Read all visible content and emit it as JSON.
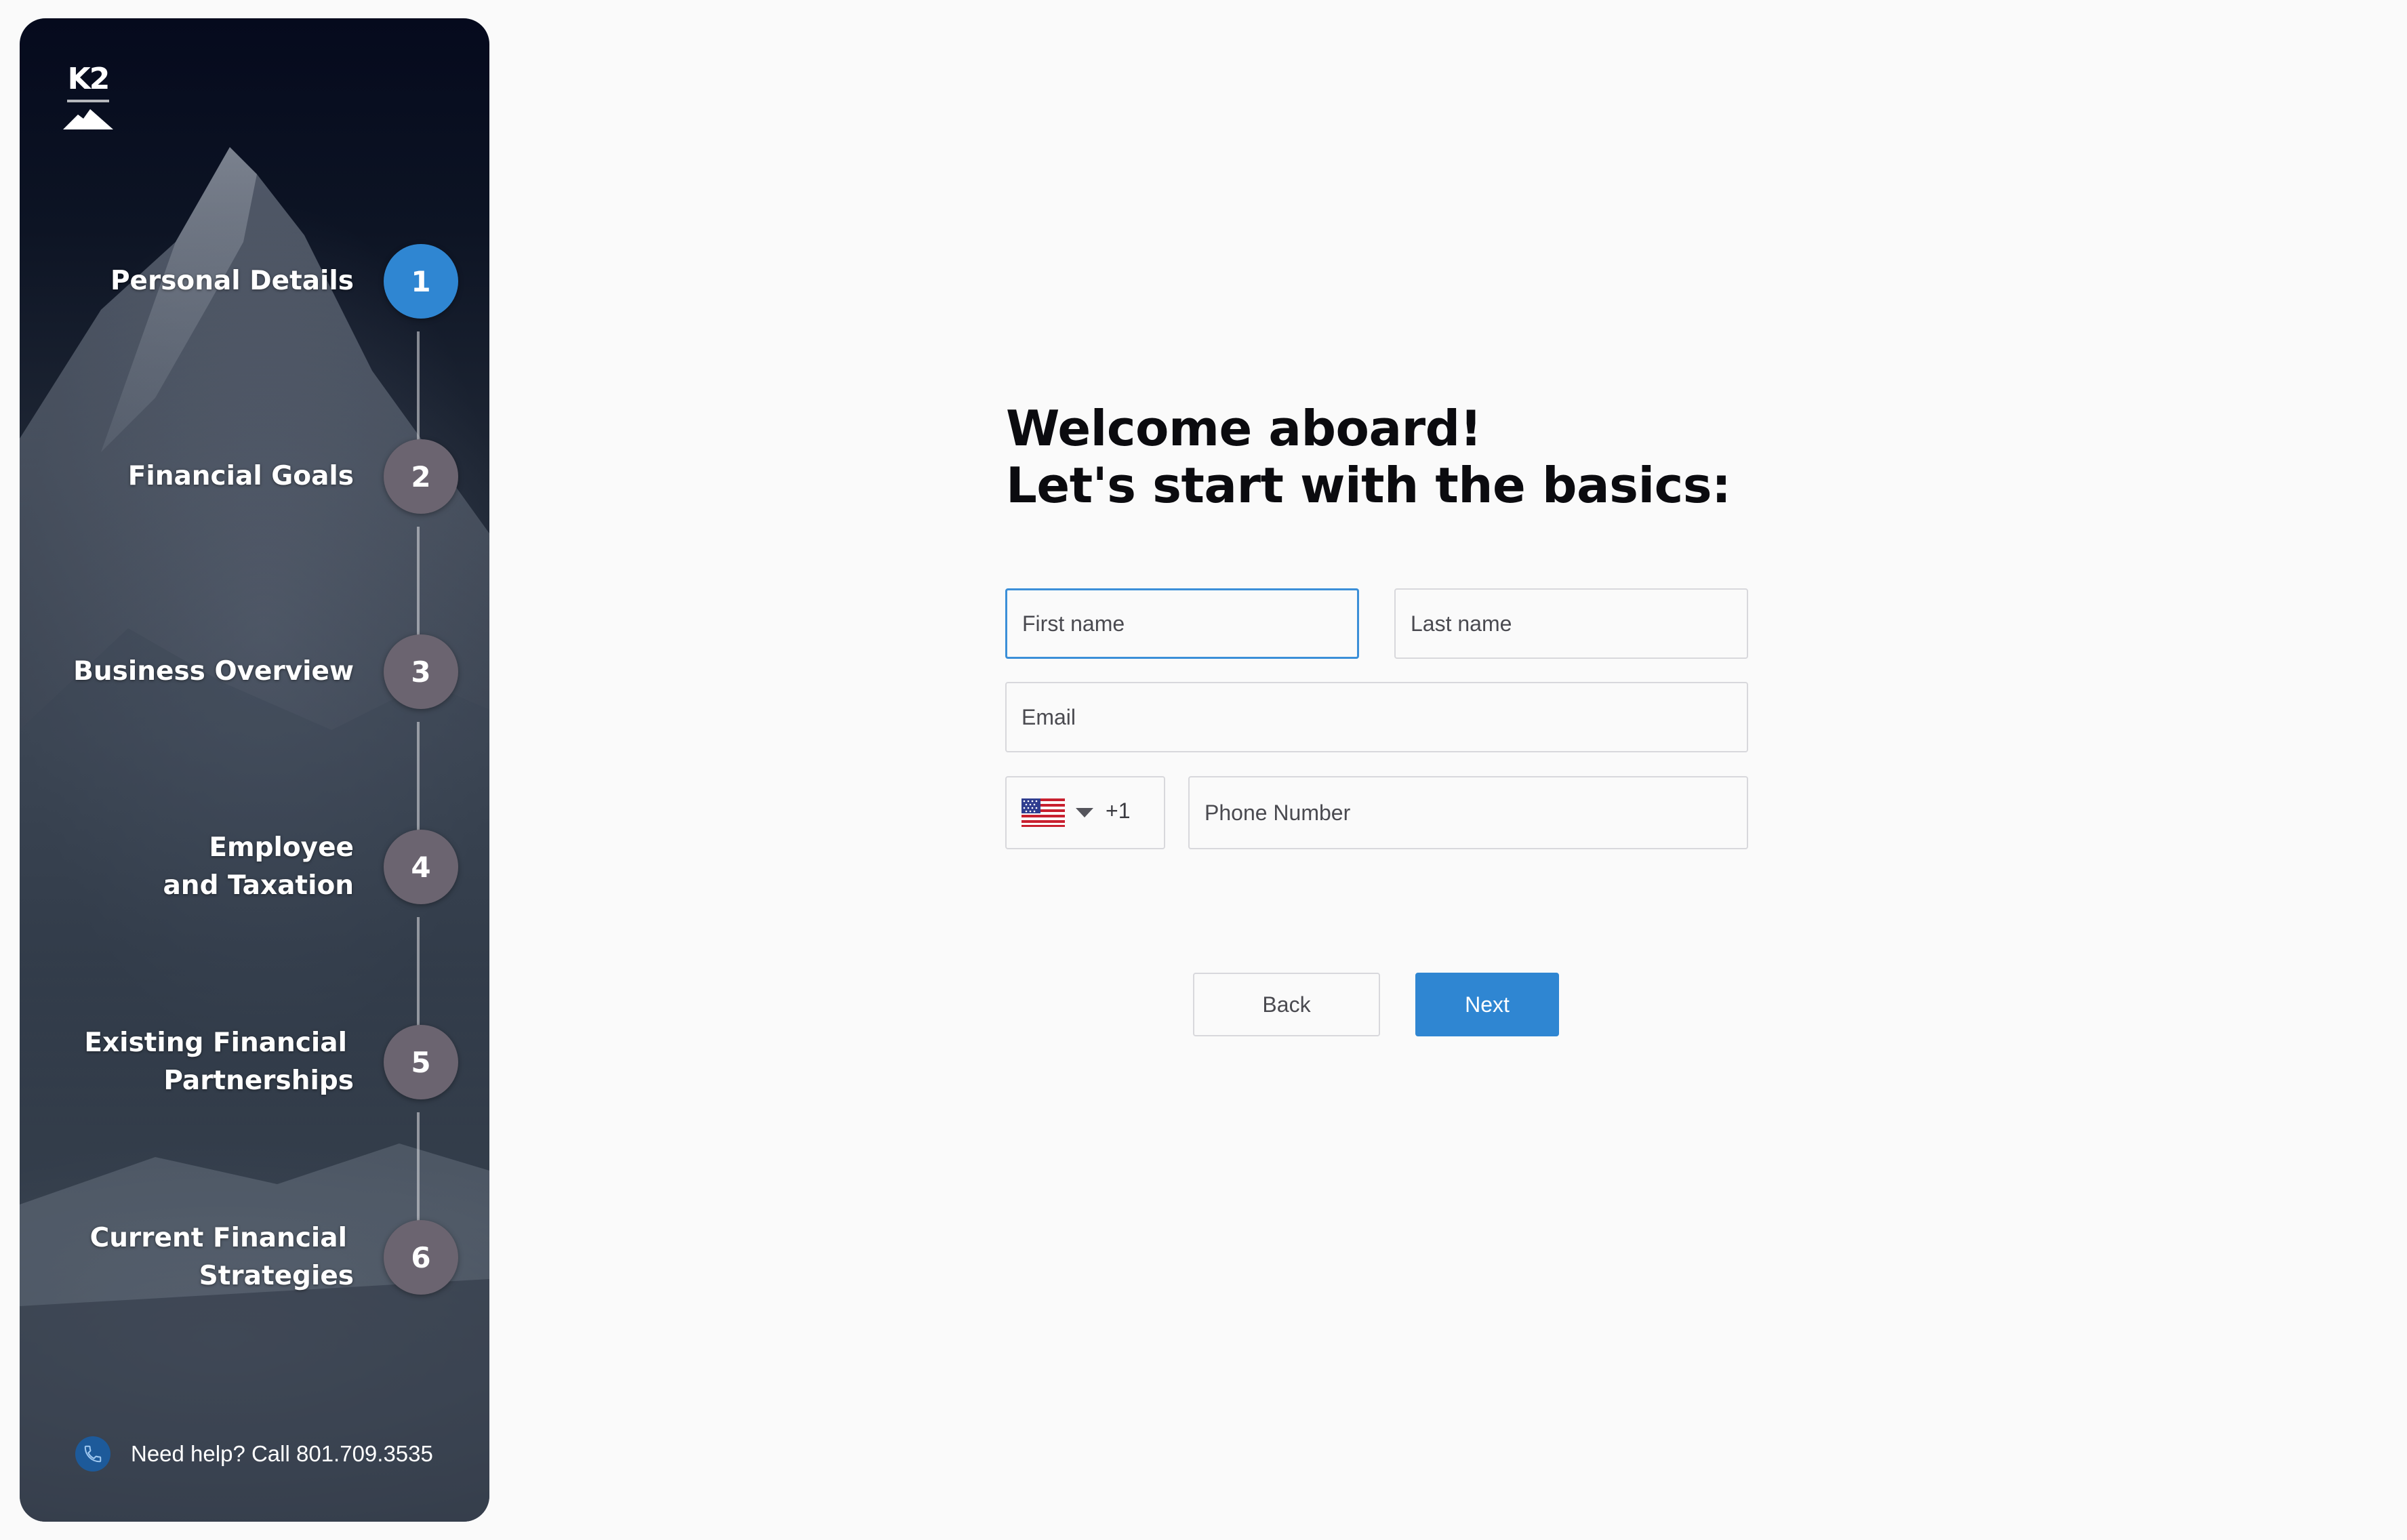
{
  "sidebar": {
    "logo_text": "K2",
    "steps": [
      {
        "number": "1",
        "label": "Personal Details",
        "active": true
      },
      {
        "number": "2",
        "label": "Financial Goals",
        "active": false
      },
      {
        "number": "3",
        "label": "Business Overview",
        "active": false
      },
      {
        "number": "4",
        "label_line1": "Employee",
        "label_line2": "and Taxation",
        "active": false
      },
      {
        "number": "5",
        "label_line1": "Existing Financial",
        "label_line2": "Partnerships",
        "active": false
      },
      {
        "number": "6",
        "label_line1": "Current Financial",
        "label_line2": "Strategies",
        "active": false
      }
    ],
    "help_text": "Need help? Call 801.709.3535",
    "help_icon": "phone-icon"
  },
  "main": {
    "heading_line1": "Welcome aboard!",
    "heading_line2": "Let's start with the basics:",
    "fields": {
      "first_name_placeholder": "First name",
      "last_name_placeholder": "Last name",
      "email_placeholder": "Email",
      "country_flag": "us-flag-icon",
      "dial_code": "+1",
      "phone_placeholder": "Phone Number"
    },
    "buttons": {
      "back_label": "Back",
      "next_label": "Next"
    }
  },
  "colors": {
    "accent": "#2f86d2",
    "inactive_step": "#6b6470",
    "background": "#fafafa",
    "heading": "#0b0b0f"
  }
}
